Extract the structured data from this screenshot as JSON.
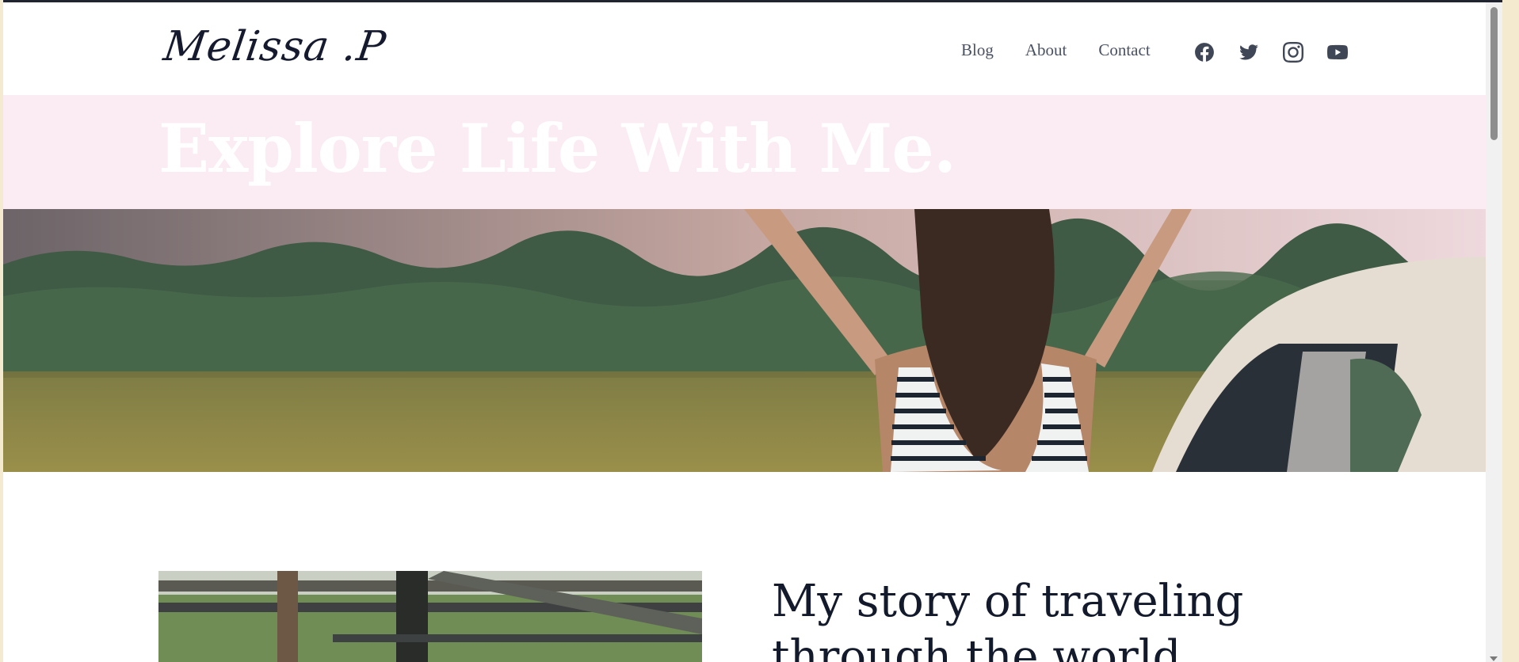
{
  "header": {
    "logo": "Melissa .P",
    "nav": [
      {
        "label": "Blog"
      },
      {
        "label": "About"
      },
      {
        "label": "Contact"
      }
    ],
    "social": [
      "facebook-icon",
      "twitter-icon",
      "instagram-icon",
      "youtube-icon"
    ]
  },
  "hero": {
    "title": "Explore Life With Me."
  },
  "story": {
    "title": "My story of traveling through the world"
  },
  "colors": {
    "hero_band": "#fbecf3",
    "text_dark": "#131a2c",
    "nav_text": "#4a5262"
  }
}
